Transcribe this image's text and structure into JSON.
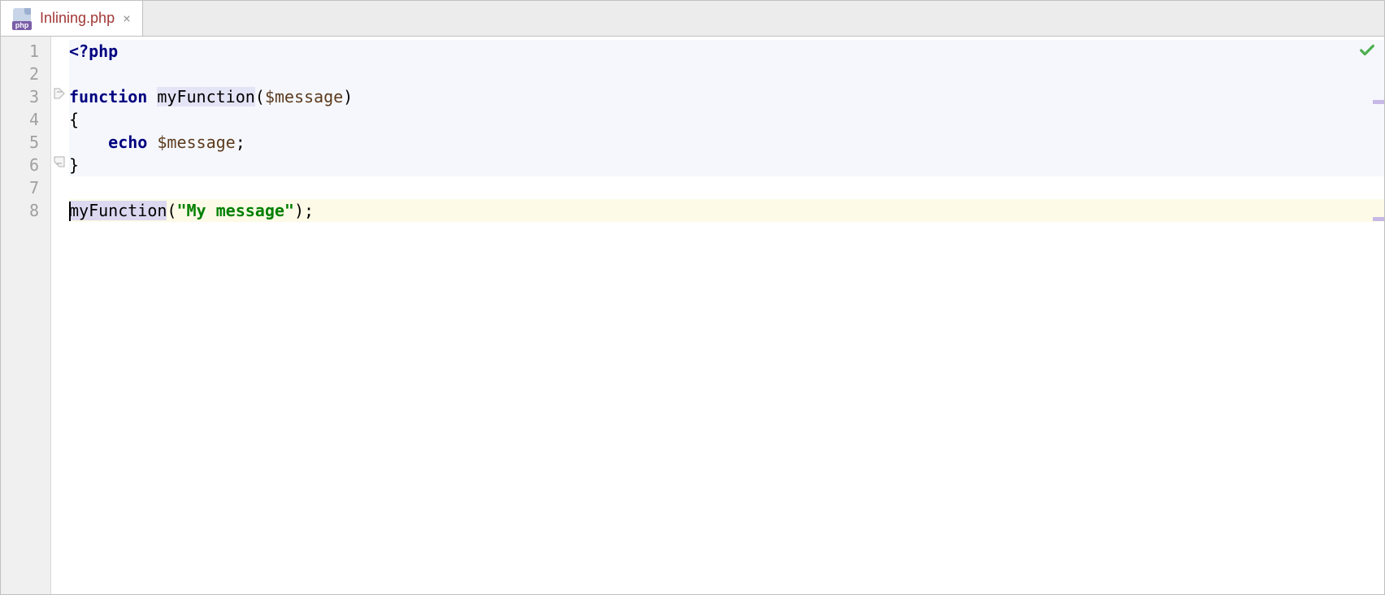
{
  "tab": {
    "icon_badge": "php",
    "filename": "Inlining.php",
    "close_glyph": "×"
  },
  "line_numbers": [
    "1",
    "2",
    "3",
    "4",
    "5",
    "6",
    "7",
    "8"
  ],
  "code": {
    "l1": {
      "tag": "<?php"
    },
    "l2": {
      "text": ""
    },
    "l3": {
      "kw": "function",
      "space": " ",
      "fn": "myFunction",
      "open": "(",
      "var": "$message",
      "close": ")"
    },
    "l4": {
      "brace": "{"
    },
    "l5": {
      "indent": "    ",
      "kw": "echo",
      "space": " ",
      "var": "$message",
      "semi": ";"
    },
    "l6": {
      "brace": "}"
    },
    "l7": {
      "text": ""
    },
    "l8": {
      "fn": "myFunction",
      "open": "(",
      "str": "\"My message\"",
      "close": ")",
      "semi": ";"
    }
  },
  "status": {
    "check_glyph": "✓"
  }
}
